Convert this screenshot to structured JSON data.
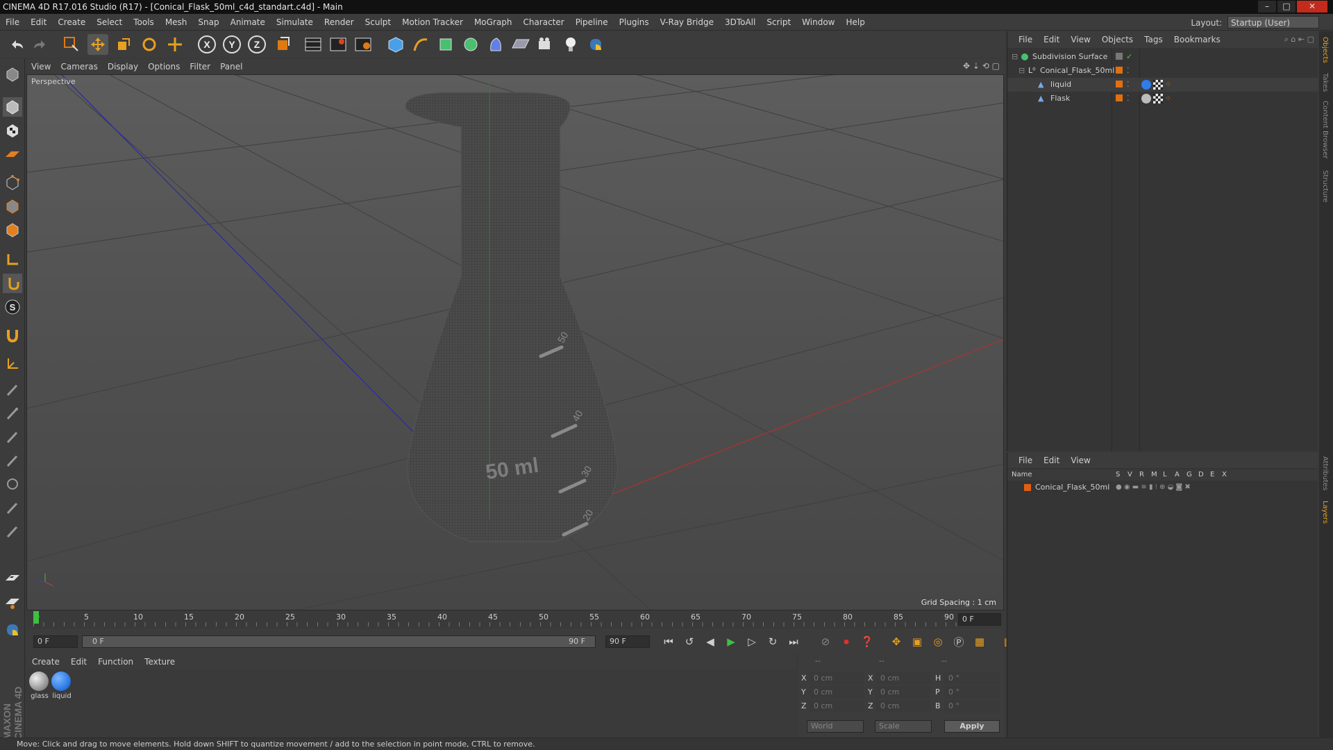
{
  "window": {
    "title": "CINEMA 4D R17.016 Studio (R17) - [Conical_Flask_50ml_c4d_standart.c4d] - Main",
    "minimize": "–",
    "maximize": "□",
    "close": "✕"
  },
  "menu": [
    "File",
    "Edit",
    "Create",
    "Select",
    "Tools",
    "Mesh",
    "Snap",
    "Animate",
    "Simulate",
    "Render",
    "Sculpt",
    "Motion Tracker",
    "MoGraph",
    "Character",
    "Pipeline",
    "Plugins",
    "V-Ray Bridge",
    "3DToAll",
    "Script",
    "Window",
    "Help"
  ],
  "layout": {
    "label": "Layout:",
    "value": "Startup (User)"
  },
  "viewport": {
    "menu": [
      "View",
      "Cameras",
      "Display",
      "Options",
      "Filter",
      "Panel"
    ],
    "camera": "Perspective",
    "grid_spacing": "Grid Spacing : 1 cm",
    "flask_label": "50 ml",
    "marks": [
      "50",
      "40",
      "30",
      "20"
    ]
  },
  "timeline": {
    "ticks": [
      "0",
      "5",
      "10",
      "15",
      "20",
      "25",
      "30",
      "35",
      "40",
      "45",
      "50",
      "55",
      "60",
      "65",
      "70",
      "75",
      "80",
      "85",
      "90"
    ],
    "end_frame_field": "0 F",
    "start": "0 F",
    "slider_start": "0 F",
    "slider_end": "90 F",
    "end": "90 F"
  },
  "materials": {
    "menu": [
      "Create",
      "Edit",
      "Function",
      "Texture"
    ],
    "items": [
      {
        "name": "glass",
        "color": "#bfbfbf"
      },
      {
        "name": "liquid",
        "color": "#2f7de8"
      }
    ]
  },
  "coords": {
    "headers": [
      "--",
      "--",
      "--"
    ],
    "rows": [
      {
        "a": "X",
        "av": "0 cm",
        "b": "X",
        "bv": "0 cm",
        "c": "H",
        "cv": "0 °"
      },
      {
        "a": "Y",
        "av": "0 cm",
        "b": "Y",
        "bv": "0 cm",
        "c": "P",
        "cv": "0 °"
      },
      {
        "a": "Z",
        "av": "0 cm",
        "b": "Z",
        "bv": "0 cm",
        "c": "B",
        "cv": "0 °"
      }
    ],
    "space": "World",
    "mode": "Scale",
    "apply": "Apply"
  },
  "objects": {
    "menu": [
      "File",
      "Edit",
      "View",
      "Objects",
      "Tags",
      "Bookmarks"
    ],
    "tree": [
      {
        "name": "Subdivision Surface",
        "level": 0
      },
      {
        "name": "Conical_Flask_50ml",
        "level": 1
      },
      {
        "name": "liquid",
        "level": 2
      },
      {
        "name": "Flask",
        "level": 2
      }
    ]
  },
  "layers": {
    "menu": [
      "File",
      "Edit",
      "View"
    ],
    "columns": [
      "Name",
      "S",
      "V",
      "R",
      "M",
      "L",
      "A",
      "G",
      "D",
      "E",
      "X"
    ],
    "rows": [
      {
        "name": "Conical_Flask_50ml",
        "color": "#e06010"
      }
    ]
  },
  "side_tabs": [
    "Objects",
    "Takes",
    "Content Browser",
    "Structure",
    "Attributes",
    "Layers"
  ],
  "status": "Move: Click and drag to move elements. Hold down SHIFT to quantize movement / add to the selection in point mode, CTRL to remove.",
  "brand": "MAXON CINEMA 4D",
  "colors": {
    "accent_orange": "#e07a10",
    "blue": "#2f7de8",
    "panel": "#3c3c3c"
  }
}
